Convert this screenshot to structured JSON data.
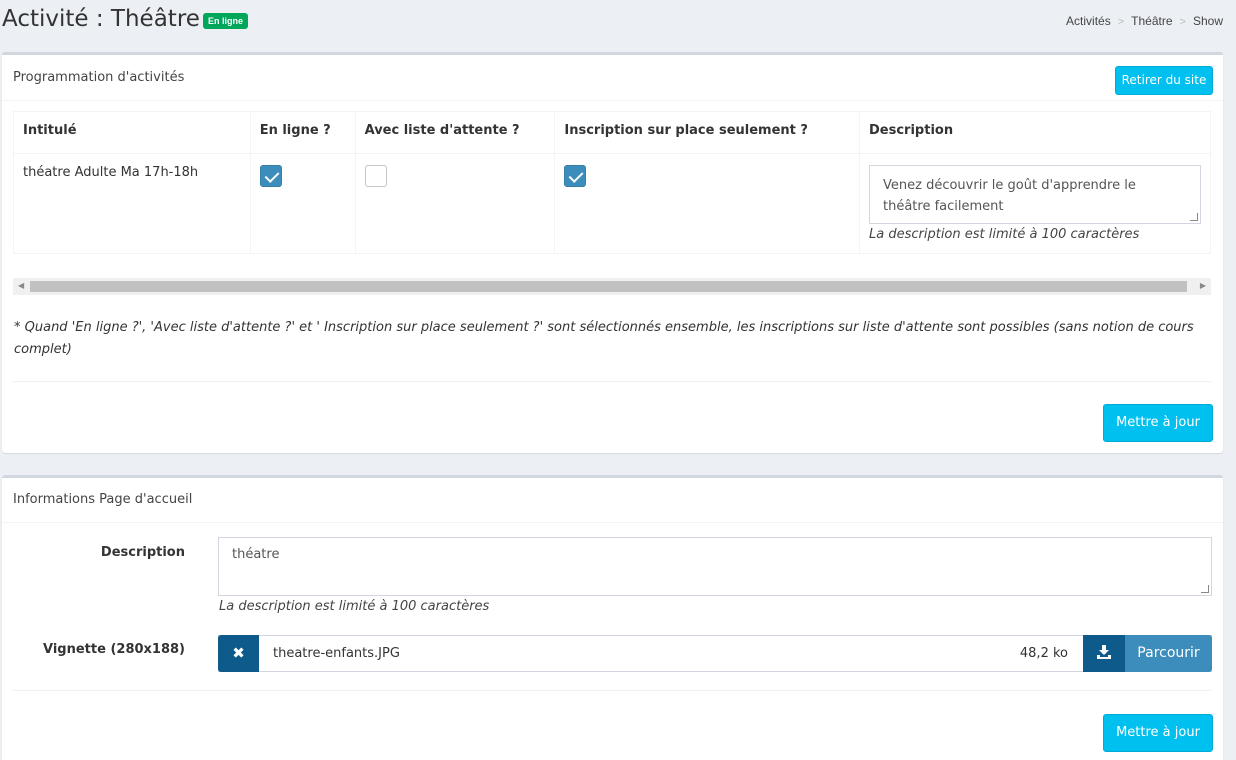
{
  "header": {
    "title": "Activité : Théâtre",
    "status_badge": "En ligne",
    "breadcrumb": [
      "Activités",
      "Théâtre",
      "Show"
    ],
    "breadcrumb_sep": ">"
  },
  "programmation": {
    "title": "Programmation d'activités",
    "remove_button": "Retirer du site",
    "columns": [
      "Intitulé",
      "En ligne ?",
      "Avec liste d'attente ?",
      "Inscription sur place seulement ?",
      "Description"
    ],
    "rows": [
      {
        "intitule": "théatre Adulte Ma 17h-18h",
        "en_ligne": true,
        "liste_attente": false,
        "sur_place": true,
        "description": "Venez découvrir le goût d'apprendre le théâtre facilement",
        "description_help": "La description est limité à 100 caractères"
      }
    ],
    "note": "* Quand 'En ligne ?', 'Avec liste d'attente ?' et ' Inscription sur place seulement ?' sont sélectionnés ensemble, les inscriptions sur liste d'attente sont possibles (sans notion de cours complet)",
    "update_button": "Mettre à jour"
  },
  "accueil": {
    "title": "Informations Page d'accueil",
    "description_label": "Description",
    "description_value": "théatre",
    "description_help": "La description est limité à 100 caractères",
    "thumbnail_label": "Vignette (280x188)",
    "file_name": "theatre-enfants.JPG",
    "file_size": "48,2 ko",
    "browse_button": "Parcourir",
    "remove_icon": "✖",
    "update_button": "Mettre à jour"
  },
  "colors": {
    "accent": "#00c0ef",
    "checkbox": "#3c8dbc",
    "badge": "#00a65a",
    "file_buttons": "#0e5a8a"
  }
}
